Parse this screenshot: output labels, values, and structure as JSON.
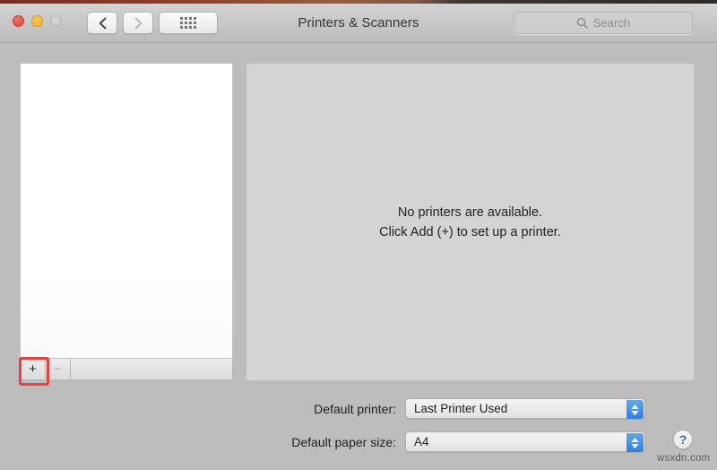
{
  "window": {
    "title": "Printers & Scanners",
    "traffic_lights": [
      {
        "name": "close",
        "color": "#e0483c"
      },
      {
        "name": "minimize",
        "color": "#f1b01f"
      },
      {
        "name": "zoom",
        "color": "#c3c3c3"
      }
    ]
  },
  "toolbar": {
    "back_label": "‹",
    "forward_label": "›",
    "show_all_label": "show-all-grid",
    "search": {
      "placeholder": "Search",
      "value": ""
    }
  },
  "printer_list": {
    "items": [],
    "add_label": "+",
    "remove_label": "−",
    "highlight_color": "#ec3f38"
  },
  "detail": {
    "empty_line1": "No printers are available.",
    "empty_line2": "Click Add (+) to set up a printer."
  },
  "settings": {
    "default_printer": {
      "label": "Default printer:",
      "value": "Last Printer Used"
    },
    "default_paper_size": {
      "label": "Default paper size:",
      "value": "A4"
    }
  },
  "help": {
    "label": "?"
  },
  "watermark": {
    "text": "wsxdn.com"
  }
}
